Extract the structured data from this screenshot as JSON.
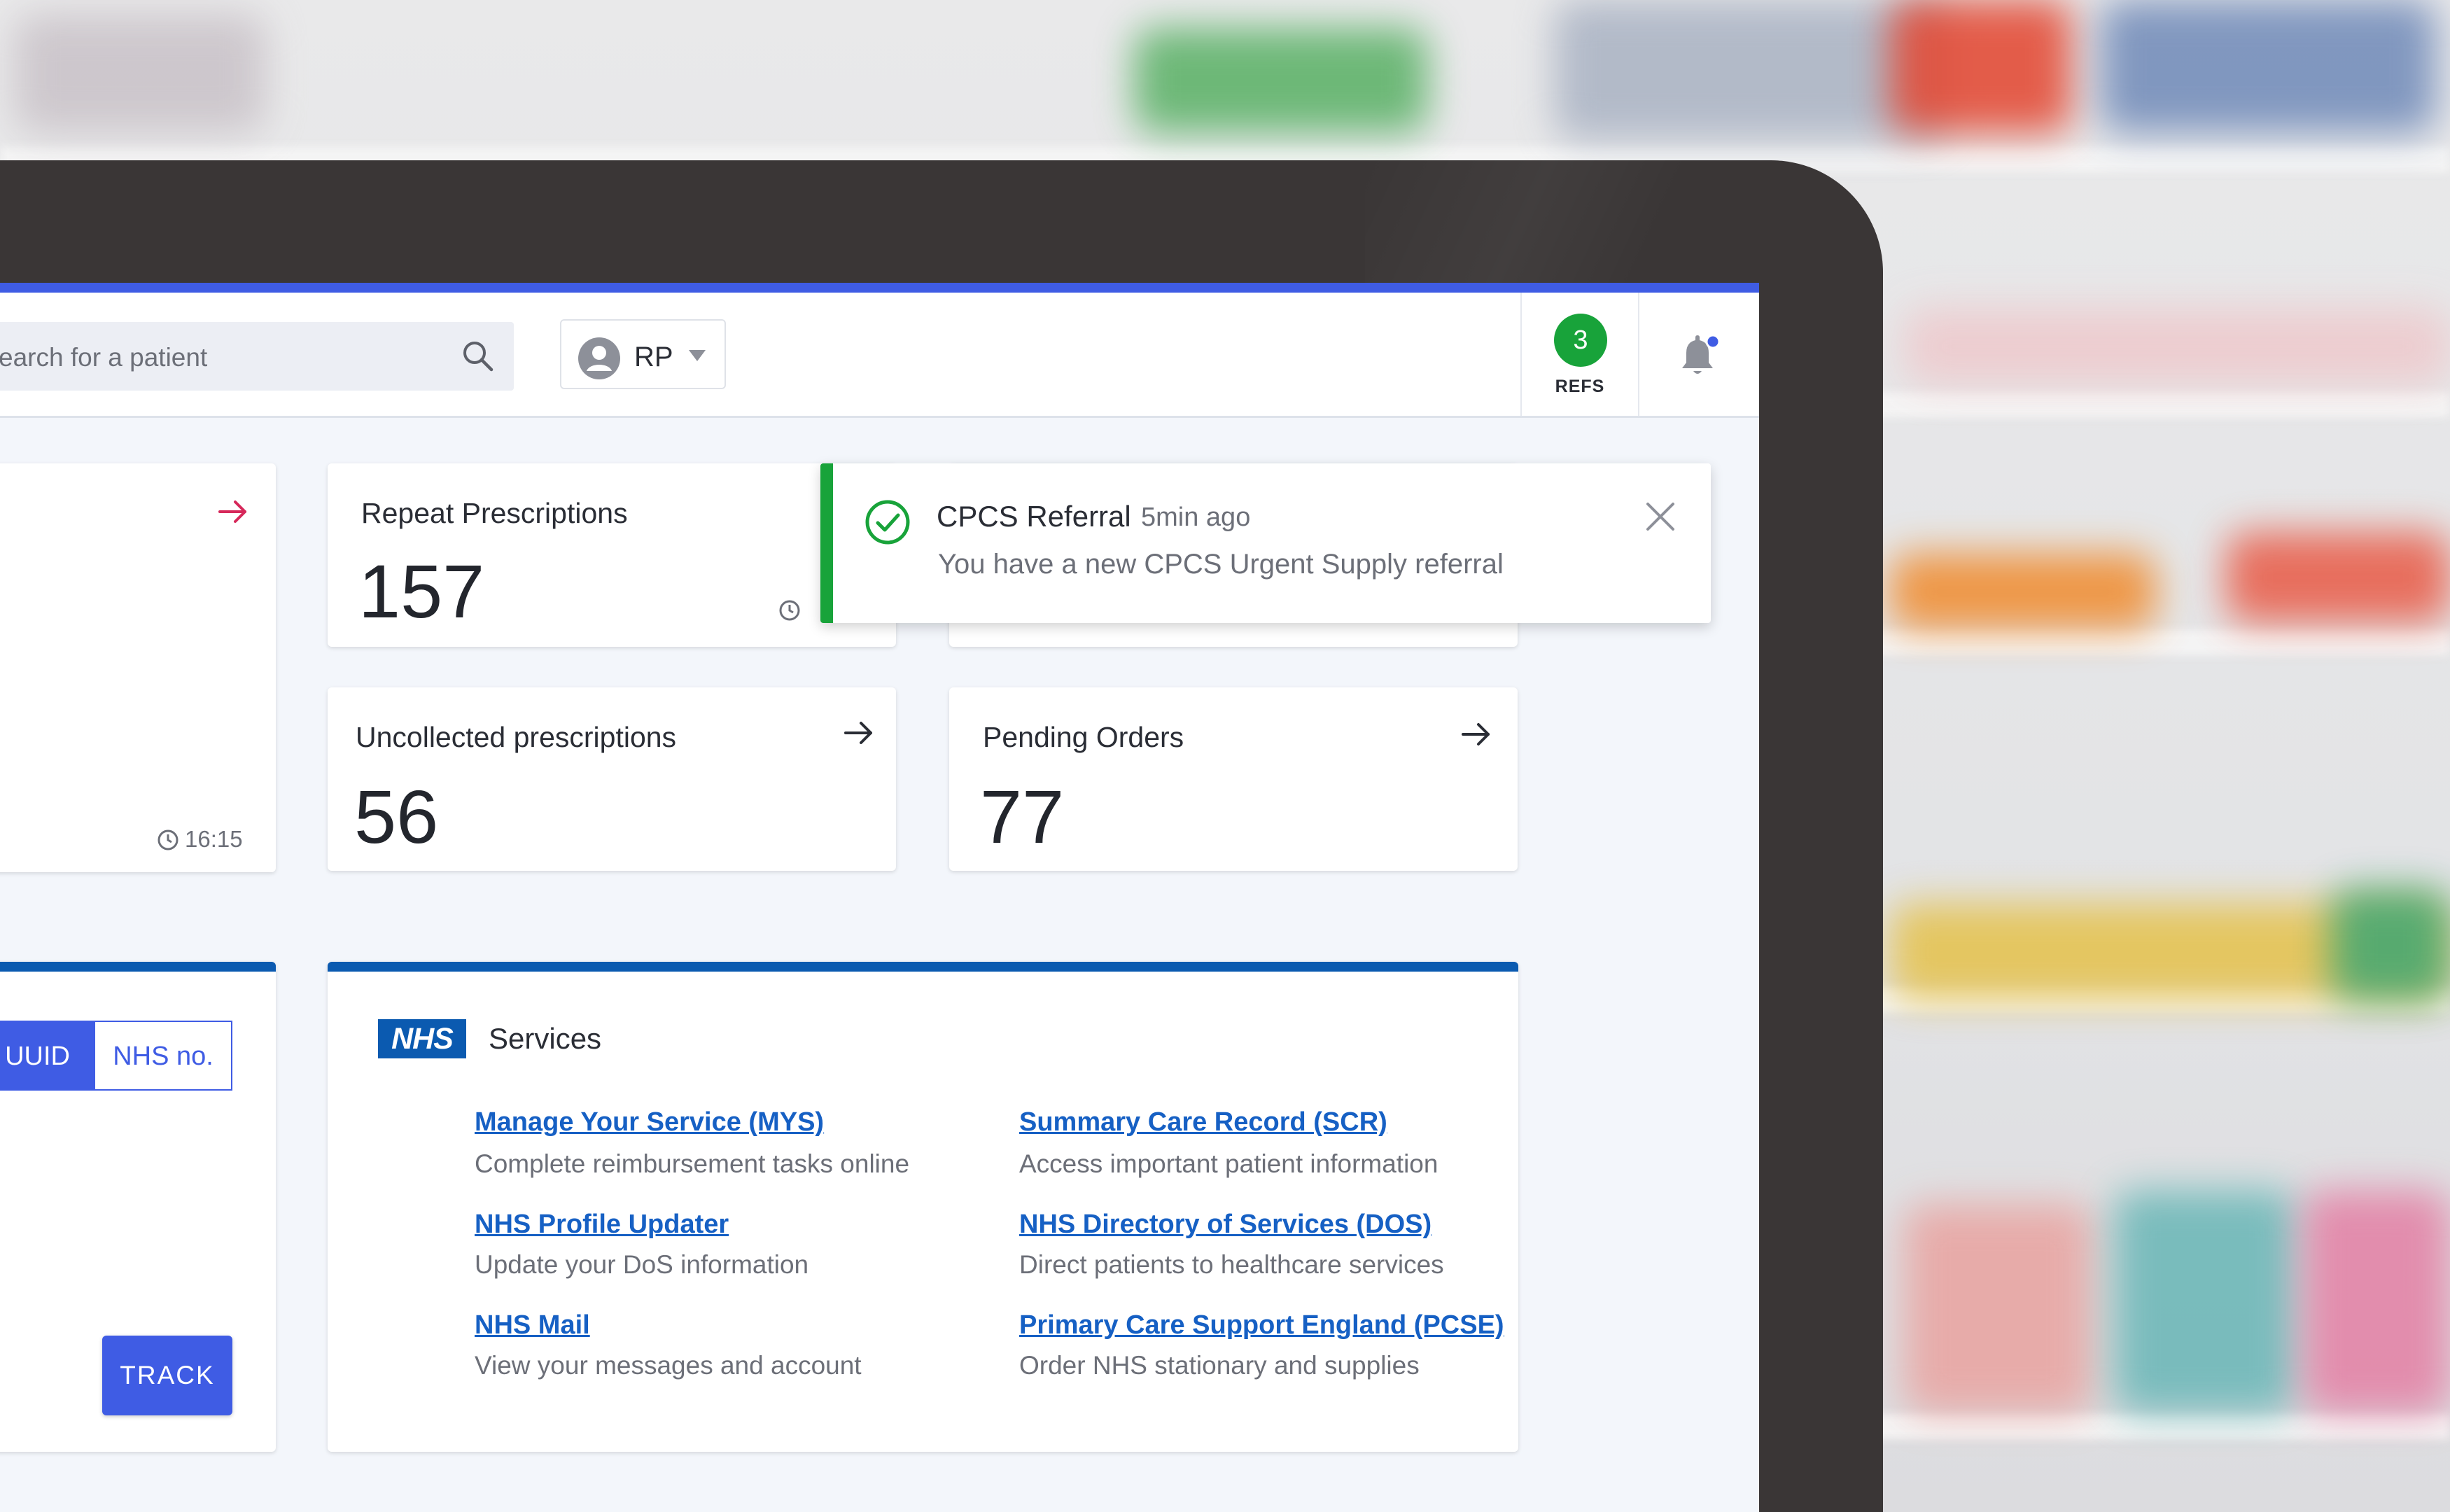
{
  "header": {
    "search_placeholder": "earch for a patient",
    "user_initials": "RP",
    "refs_count": "3",
    "refs_label": "REFS"
  },
  "cards": {
    "first_card_time": "16:15",
    "repeat_title": "Repeat Prescriptions",
    "repeat_value": "157",
    "uncollected_title": "Uncollected prescriptions",
    "uncollected_value": "56",
    "pending_title": "Pending Orders",
    "pending_value": "77"
  },
  "toast": {
    "title": "CPCS Referral",
    "time": "5min ago",
    "body": "You have a new CPCS Urgent Supply referral"
  },
  "lookup": {
    "seg_uuid": "UUID",
    "seg_nhs": "NHS no.",
    "track_label": "TRACK"
  },
  "services": {
    "logo": "NHS",
    "title": "Services",
    "items": [
      {
        "link": "Manage Your Service (MYS)",
        "desc": "Complete reimbursement tasks online"
      },
      {
        "link": "Summary Care Record (SCR)",
        "desc": "Access important patient information"
      },
      {
        "link": "NHS Profile Updater",
        "desc": "Update your DoS information"
      },
      {
        "link": "NHS Directory of Services (DOS)",
        "desc": "Direct patients to healthcare services"
      },
      {
        "link": "NHS Mail",
        "desc": "View your messages and account"
      },
      {
        "link": "Primary Care Support England (PCSE)",
        "desc": "Order NHS stationary and supplies"
      }
    ]
  },
  "colors": {
    "accent": "#3f5ce4",
    "nhs_blue": "#0b5ab0",
    "success": "#18a33a",
    "alert_arrow": "#d6285a"
  },
  "icons": [
    "search-icon",
    "avatar-icon",
    "chevron-down-icon",
    "bell-icon",
    "arrow-right-icon",
    "clock-icon",
    "check-circle-icon",
    "close-icon"
  ]
}
